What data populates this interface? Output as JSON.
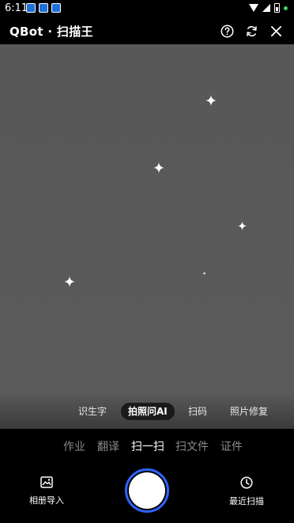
{
  "status_bar": {
    "time": "6:11"
  },
  "header": {
    "title": "QBot · 扫描王"
  },
  "icons": {
    "help": "question-circle-icon",
    "rotate": "refresh-icon",
    "close": "close-icon",
    "gallery": "image-icon",
    "history": "clock-icon",
    "sparkle": "sparkle-icon"
  },
  "modes": [
    {
      "label": "识生字",
      "active": false
    },
    {
      "label": "拍照问AI",
      "active": true
    },
    {
      "label": "扫码",
      "active": false
    },
    {
      "label": "照片修复",
      "active": false
    }
  ],
  "tabs": [
    {
      "label": "作业",
      "active": false
    },
    {
      "label": "翻译",
      "active": false
    },
    {
      "label": "扫一扫",
      "active": true
    },
    {
      "label": "扫文件",
      "active": false
    },
    {
      "label": "证件",
      "active": false
    }
  ],
  "bottom": {
    "album_label": "相册导入",
    "recent_label": "最近扫描"
  },
  "colors": {
    "accent": "#2f64ff",
    "preview_bg": "#585858"
  }
}
